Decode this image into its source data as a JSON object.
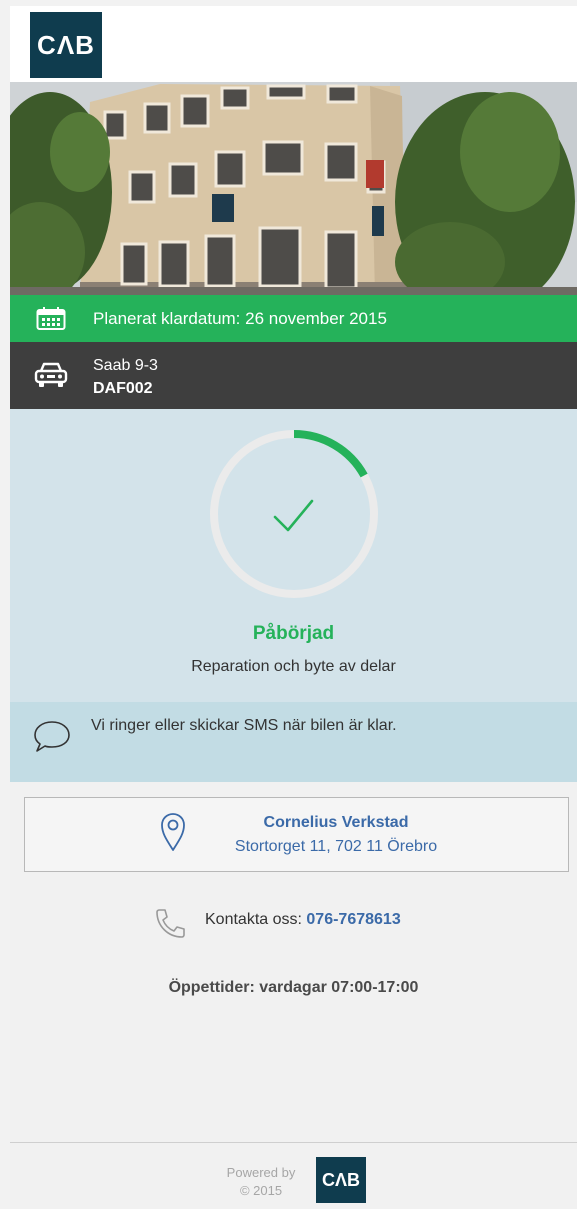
{
  "header": {
    "logo_text": "CΛB"
  },
  "photo": {
    "alt": "workshop-building-photo"
  },
  "schedule": {
    "label": "Planerat klardatum: 26 november 2015",
    "icon": "calendar-icon"
  },
  "vehicle": {
    "model": "Saab 9-3",
    "plate": "DAF002",
    "icon": "car-icon"
  },
  "status": {
    "title": "Påbörjad",
    "description": "Reparation och byte av delar",
    "progress_fraction": 0.17,
    "icon": "checkmark-icon"
  },
  "notice": {
    "text": "Vi ringer eller skickar SMS när bilen är klar.",
    "icon": "speech-bubble-icon"
  },
  "location": {
    "name": "Cornelius Verkstad",
    "address": "Stortorget 11, 702 11 Örebro",
    "icon": "map-pin-icon"
  },
  "contact": {
    "label": "Kontakta oss:",
    "phone": "076-7678613",
    "icon": "phone-icon"
  },
  "hours": {
    "text": "Öppettider: vardagar 07:00-17:00"
  },
  "footer": {
    "powered_by": "Powered by",
    "copyright": "© 2015",
    "logo_text": "CΛB"
  },
  "colors": {
    "brand": "#0f3c4e",
    "green": "#25b25a",
    "dark_bar": "#3e3e3e",
    "status_bg": "#d3e3ea",
    "notice_bg": "#c2dce4",
    "link": "#3b6aa8"
  }
}
